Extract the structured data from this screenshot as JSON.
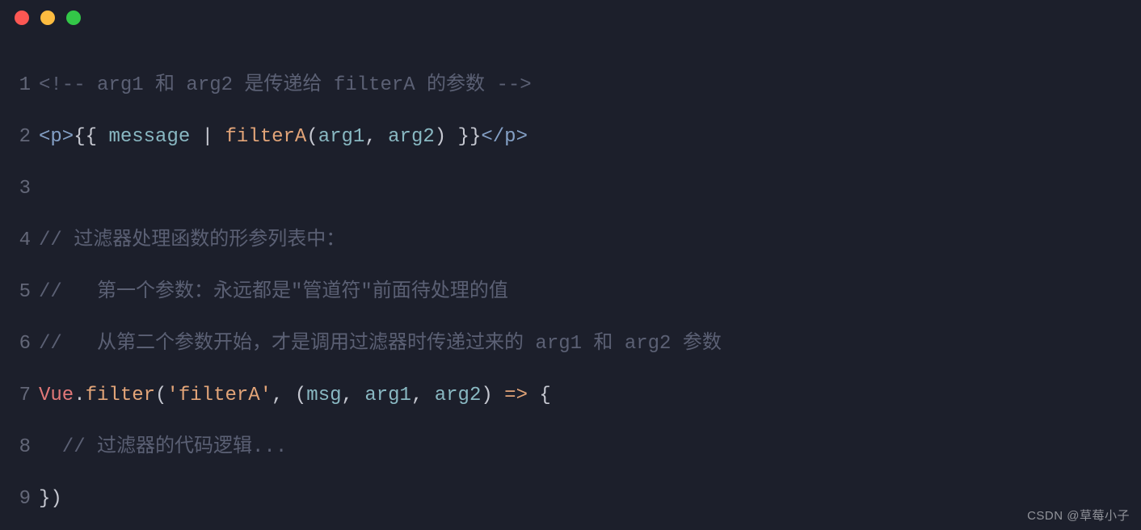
{
  "titlebar": {
    "buttons": [
      "close",
      "minimize",
      "zoom"
    ]
  },
  "lines": [
    {
      "n": "1",
      "segments": [
        {
          "cls": "tok-comment",
          "text": "<!-- arg1 和 arg2 是传递给 filterA 的参数 -->"
        }
      ]
    },
    {
      "n": "2",
      "segments": [
        {
          "cls": "tok-tag",
          "text": "<p>"
        },
        {
          "cls": "tok-punct",
          "text": "{{ "
        },
        {
          "cls": "tok-var",
          "text": "message"
        },
        {
          "cls": "tok-punct",
          "text": " | "
        },
        {
          "cls": "tok-func",
          "text": "filterA"
        },
        {
          "cls": "tok-punct",
          "text": "("
        },
        {
          "cls": "tok-var",
          "text": "arg1"
        },
        {
          "cls": "tok-punct",
          "text": ", "
        },
        {
          "cls": "tok-var",
          "text": "arg2"
        },
        {
          "cls": "tok-punct",
          "text": ") }}"
        },
        {
          "cls": "tok-tag",
          "text": "</p>"
        }
      ]
    },
    {
      "n": "3",
      "segments": []
    },
    {
      "n": "4",
      "segments": [
        {
          "cls": "tok-comment",
          "text": "// 过滤器处理函数的形参列表中："
        }
      ]
    },
    {
      "n": "5",
      "segments": [
        {
          "cls": "tok-comment",
          "text": "//   第一个参数：永远都是\"管道符\"前面待处理的值"
        }
      ]
    },
    {
      "n": "6",
      "segments": [
        {
          "cls": "tok-comment",
          "text": "//   从第二个参数开始，才是调用过滤器时传递过来的 arg1 和 arg2 参数"
        }
      ]
    },
    {
      "n": "7",
      "segments": [
        {
          "cls": "tok-key",
          "text": "Vue"
        },
        {
          "cls": "tok-punct",
          "text": "."
        },
        {
          "cls": "tok-func",
          "text": "filter"
        },
        {
          "cls": "tok-punct",
          "text": "("
        },
        {
          "cls": "tok-str",
          "text": "'filterA'"
        },
        {
          "cls": "tok-punct",
          "text": ", ("
        },
        {
          "cls": "tok-var",
          "text": "msg"
        },
        {
          "cls": "tok-punct",
          "text": ", "
        },
        {
          "cls": "tok-var",
          "text": "arg1"
        },
        {
          "cls": "tok-punct",
          "text": ", "
        },
        {
          "cls": "tok-var",
          "text": "arg2"
        },
        {
          "cls": "tok-punct",
          "text": ") "
        },
        {
          "cls": "tok-keyword",
          "text": "=>"
        },
        {
          "cls": "tok-punct",
          "text": " {"
        }
      ]
    },
    {
      "n": "8",
      "segments": [
        {
          "cls": "tok-comment",
          "text": "  // 过滤器的代码逻辑..."
        }
      ]
    },
    {
      "n": "9",
      "segments": [
        {
          "cls": "tok-punct",
          "text": "})"
        }
      ]
    }
  ],
  "watermark": "CSDN @草莓小子"
}
